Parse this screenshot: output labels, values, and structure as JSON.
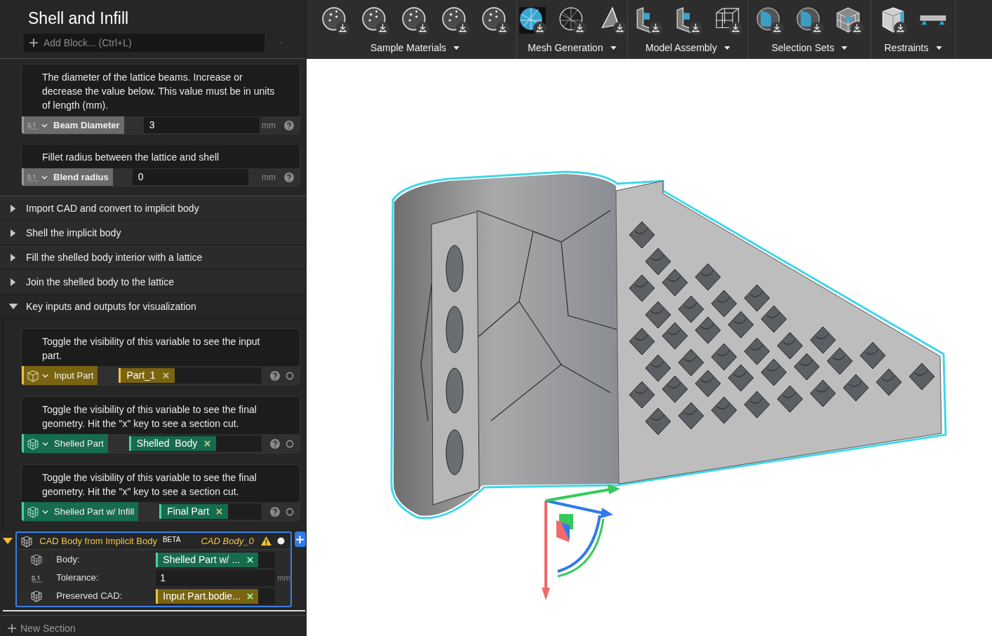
{
  "panel": {
    "title": "Shell and Infill",
    "add_block": {
      "placeholder": "Add Block... (Ctrl+L)"
    },
    "params": [
      {
        "description": "The diameter of the lattice beams. Increase or decrease the value below. This value must be in units of length (mm).",
        "label": "Beam Diameter",
        "value": "3",
        "unit": "mm"
      },
      {
        "description": "Fillet radius between the lattice and shell",
        "label": "Blend radius",
        "value": "0",
        "unit": "mm"
      }
    ],
    "sections": [
      {
        "label": "Import CAD and convert to implicit body",
        "expanded": false
      },
      {
        "label": "Shell the implicit body",
        "expanded": false
      },
      {
        "label": "Fill the shelled body interior with a lattice",
        "expanded": false
      },
      {
        "label": "Join the shelled body to the lattice",
        "expanded": false
      },
      {
        "label": "Key inputs and outputs for visualization",
        "expanded": true
      }
    ],
    "variables": [
      {
        "description": "Toggle the visibility of this variable to see the input part.",
        "label": "Input Part",
        "tag": "Part_1",
        "color": "#e8c44a"
      },
      {
        "description": "Toggle the visibility of this variable to see the final geometry. Hit the \"x\" key to see a section cut.",
        "label": "Shelled Part",
        "tag": "Shelled  Body",
        "color": "#4fd1a1"
      },
      {
        "description": "Toggle the visibility of this variable to see the final geometry. Hit the \"x\" key to see a section cut.",
        "label": "Shelled Part w/ Infill",
        "tag": "Final Part",
        "color": "#4fd1a1"
      }
    ],
    "cad_block": {
      "title": "CAD Body from Implicit Body",
      "badge": "BETA",
      "output": "CAD Body_0",
      "expanded": true,
      "selected": true,
      "fields": [
        {
          "kind": "tag",
          "label": "Body:",
          "value": "Shelled Part w/ ...",
          "color": "#4fd1a1"
        },
        {
          "kind": "number",
          "label": "Tolerance:",
          "value": "1",
          "unit": "mm"
        },
        {
          "kind": "tag",
          "label": "Preserved CAD:",
          "value": "Input Part.bodie...",
          "color": "#e8c44a"
        }
      ]
    },
    "new_section": "New Section"
  },
  "toolbar": [
    {
      "label": "Sample Materials"
    },
    {
      "label": "Mesh Generation"
    },
    {
      "label": "Model Assembly"
    },
    {
      "label": "Selection Sets"
    },
    {
      "label": "Restraints"
    }
  ]
}
